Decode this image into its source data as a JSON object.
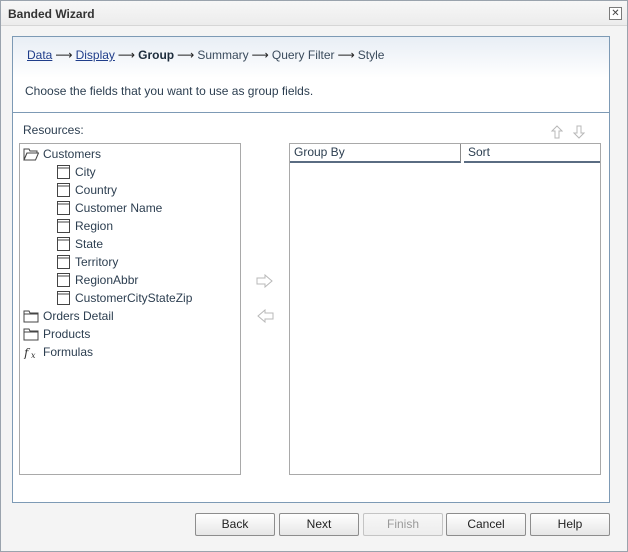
{
  "window": {
    "title": "Banded Wizard",
    "close_glyph": "✕"
  },
  "wizard": {
    "steps": [
      {
        "label": "Data",
        "state": "link"
      },
      {
        "label": "Display",
        "state": "link"
      },
      {
        "label": "Group",
        "state": "current"
      },
      {
        "label": "Summary",
        "state": "pending"
      },
      {
        "label": "Query Filter",
        "state": "pending"
      },
      {
        "label": "Style",
        "state": "pending"
      }
    ],
    "arrow_glyph": "⟶",
    "instruction": "Choose the fields that you want to use as group fields."
  },
  "resources": {
    "label": "Resources:",
    "tree": [
      {
        "label": "Customers",
        "icon": "folder-open-icon",
        "level": 0
      },
      {
        "label": "City",
        "icon": "field-icon",
        "level": 1
      },
      {
        "label": "Country",
        "icon": "field-icon",
        "level": 1
      },
      {
        "label": "Customer Name",
        "icon": "field-icon",
        "level": 1
      },
      {
        "label": "Region",
        "icon": "field-icon",
        "level": 1
      },
      {
        "label": "State",
        "icon": "field-icon",
        "level": 1
      },
      {
        "label": "Territory",
        "icon": "field-icon",
        "level": 1
      },
      {
        "label": "RegionAbbr",
        "icon": "field-icon",
        "level": 1
      },
      {
        "label": "CustomerCityStateZip",
        "icon": "field-icon",
        "level": 1
      },
      {
        "label": "Orders Detail",
        "icon": "folder-icon",
        "level": 0
      },
      {
        "label": "Products",
        "icon": "folder-icon",
        "level": 0
      },
      {
        "label": "Formulas",
        "icon": "formula-icon",
        "level": 0
      }
    ]
  },
  "group_table": {
    "columns": [
      "Group By",
      "Sort"
    ],
    "rows": []
  },
  "footer": {
    "back": "Back",
    "next": "Next",
    "finish": "Finish",
    "cancel": "Cancel",
    "help": "Help"
  },
  "colors": {
    "link": "#1f3d8a",
    "panel_border": "#7d9ab5",
    "disabled_text": "#9a9a9a",
    "arrow_disabled": "#b8b8b8"
  }
}
